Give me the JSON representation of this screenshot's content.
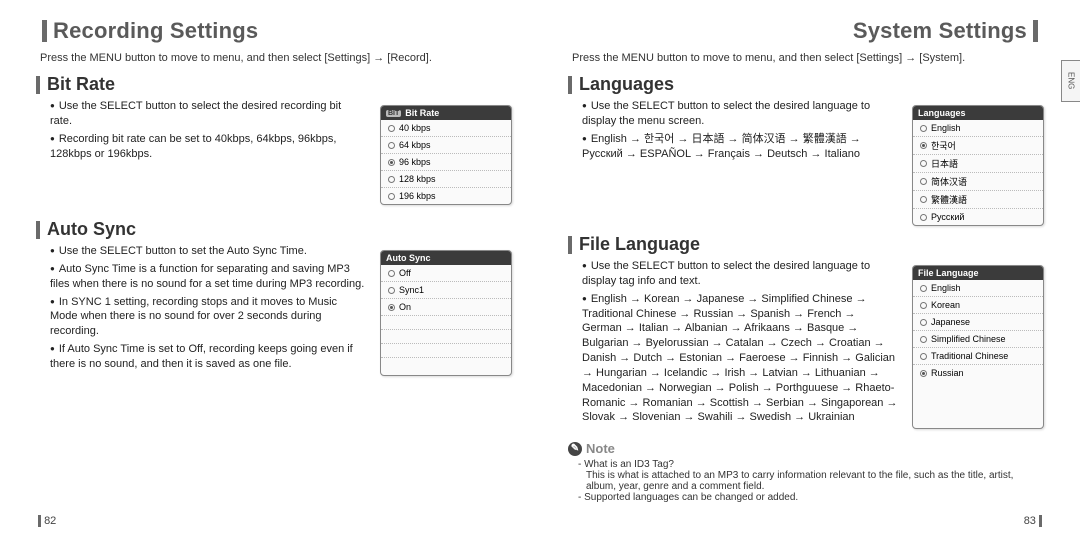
{
  "left": {
    "title": "Recording Settings",
    "intro": "Press the MENU button to move to menu, and then select [Settings] → [Record].",
    "bitrate": {
      "heading": "Bit Rate",
      "bullets": [
        "Use the SELECT button to select the desired recording bit rate.",
        "Recording bit rate can be set to 40kbps, 64kbps, 96kbps, 128kbps or 196kbps."
      ],
      "screen": {
        "badge": "BIT",
        "title": "Bit Rate",
        "items": [
          "40 kbps",
          "64 kbps",
          "96 kbps",
          "128 kbps",
          "196 kbps"
        ],
        "selected": 2
      }
    },
    "autosync": {
      "heading": "Auto Sync",
      "bullets": [
        "Use the SELECT button to set the Auto Sync Time.",
        "Auto Sync Time is a function for separating and saving MP3 files when there is no sound for a set time during MP3 recording.",
        "In SYNC 1 setting, recording stops and it moves to Music Mode when there is no sound for over 2 seconds during recording.",
        "If Auto Sync Time is set to Off, recording keeps going even if there is no sound, and then it is saved as one file."
      ],
      "screen": {
        "title": "Auto Sync",
        "items": [
          "Off",
          "Sync1",
          "On"
        ],
        "selected": 2
      }
    },
    "page_num": "82"
  },
  "right": {
    "title": "System Settings",
    "intro": "Press the MENU button to move to menu, and then select [Settings] → [System].",
    "side_tab": "ENG",
    "languages": {
      "heading": "Languages",
      "bullets": [
        "Use the SELECT button to select the desired language to display the menu screen.",
        "English → 한국어 → 日本語 → 简体汉语 → 繁體漢語 → Русский → ESPAÑOL → Français → Deutsch → Italiano"
      ],
      "screen": {
        "title": "Languages",
        "items": [
          "English",
          "한국어",
          "日本語",
          "简体汉语",
          "繁體漢語",
          "Русский"
        ],
        "selected": 1
      }
    },
    "filelang": {
      "heading": "File Language",
      "bullets": [
        "Use the SELECT button to select the desired language to display tag info and text.",
        "English → Korean → Japanese → Simplified Chinese → Traditional Chinese → Russian → Spanish → French → German → Italian → Albanian → Afrikaans → Basque → Bulgarian → Byelorussian → Catalan → Czech → Croatian → Danish → Dutch → Estonian → Faeroese → Finnish → Galician → Hungarian → Icelandic → Irish → Latvian → Lithuanian → Macedonian → Norwegian → Polish → Porthguuese → Rhaeto-Romanic → Romanian → Scottish → Serbian → Singaporean → Slovak → Slovenian → Swahili → Swedish → Ukrainian"
      ],
      "screen": {
        "title": "File Language",
        "items": [
          "English",
          "Korean",
          "Japanese",
          "Simplified Chinese",
          "Traditional Chinese",
          "Russian"
        ],
        "selected": 5
      }
    },
    "note": {
      "label": "Note",
      "q": "- What is an ID3 Tag?",
      "a": "This is what is attached to an MP3 to carry information relevant to the file, such as the title, artist, album, year, genre and a comment field.",
      "extra": "- Supported languages can be changed or added."
    },
    "page_num": "83"
  }
}
